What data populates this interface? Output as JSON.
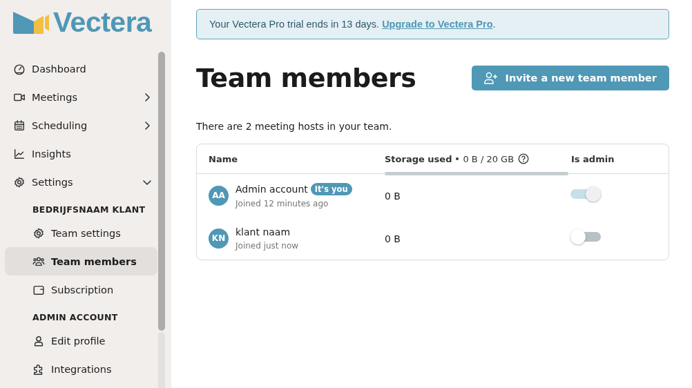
{
  "logo": {
    "text": "Vectera"
  },
  "sidebar": {
    "items": [
      {
        "kind": "nav",
        "label": "Dashboard",
        "selected": false
      },
      {
        "kind": "nav",
        "label": "Meetings",
        "selected": false,
        "expanded": false
      },
      {
        "kind": "nav",
        "label": "Scheduling",
        "selected": false,
        "expanded": false
      },
      {
        "kind": "nav",
        "label": "Insights",
        "selected": false
      },
      {
        "kind": "nav",
        "label": "Settings",
        "selected": false,
        "expanded": true
      },
      {
        "kind": "section",
        "label": "BEDRIJFSNAAM KLANT"
      },
      {
        "kind": "sub",
        "label": "Team settings",
        "selected": false
      },
      {
        "kind": "sub",
        "label": "Team members",
        "selected": true
      },
      {
        "kind": "sub",
        "label": "Subscription",
        "selected": false
      },
      {
        "kind": "section",
        "label": "ADMIN ACCOUNT"
      },
      {
        "kind": "sub",
        "label": "Edit profile",
        "selected": false
      },
      {
        "kind": "sub",
        "label": "Integrations",
        "selected": false
      }
    ]
  },
  "banner": {
    "text": "Your Vectera Pro trial ends in 13 days.",
    "link": "Upgrade to Vectera Pro",
    "suffix": "."
  },
  "title": "Team members",
  "invite_button": "Invite a new team member",
  "summary": "There are 2 meeting hosts in your team.",
  "table": {
    "columns": [
      {
        "kind": "name",
        "label": "Name"
      },
      {
        "kind": "storage",
        "label": "Storage used",
        "usage": "0 B / 20 GB"
      },
      {
        "kind": "admin",
        "label": "Is admin"
      }
    ],
    "rows": [
      {
        "initials": "AA",
        "name": "Admin account",
        "badge": "It's you",
        "joined": "Joined 12 minutes ago",
        "storage": "0 B",
        "is_admin": true
      },
      {
        "initials": "KN",
        "name": "klant naam",
        "joined": "Joined just now",
        "storage": "0 B",
        "is_admin": false
      }
    ]
  }
}
